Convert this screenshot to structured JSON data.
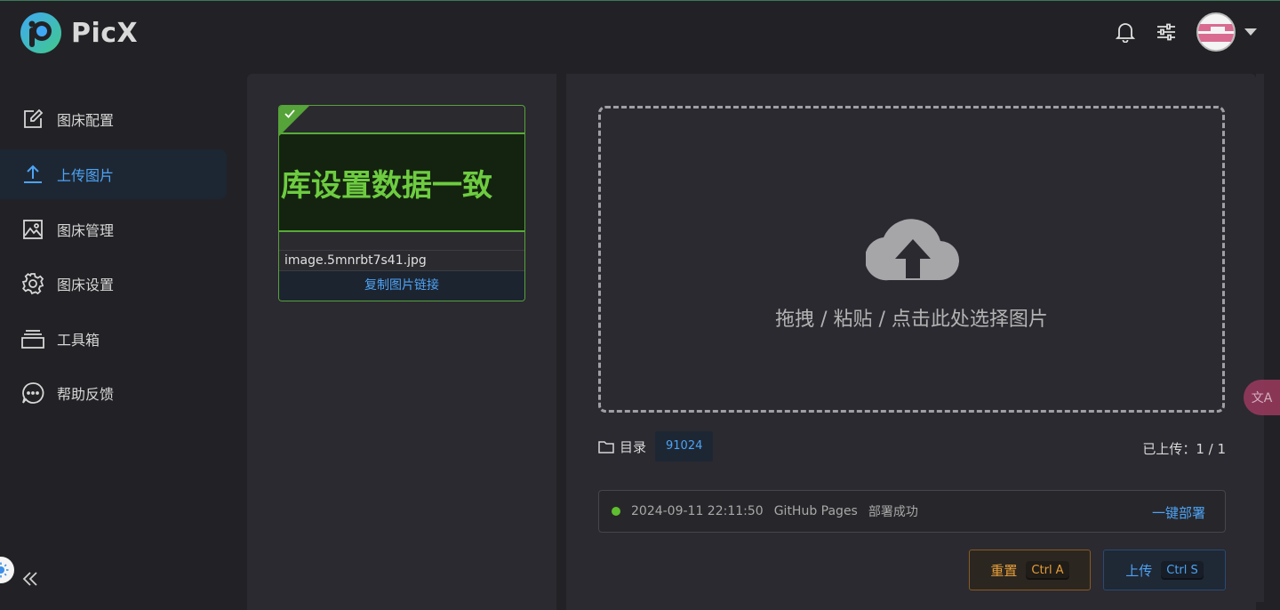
{
  "app": {
    "name": "PicX"
  },
  "sidebar": {
    "items": [
      {
        "label": "图床配置",
        "icon": "edit-icon"
      },
      {
        "label": "上传图片",
        "icon": "upload-icon",
        "active": true
      },
      {
        "label": "图床管理",
        "icon": "image-icon"
      },
      {
        "label": "图床设置",
        "icon": "gear-icon"
      },
      {
        "label": "工具箱",
        "icon": "toolbox-icon"
      },
      {
        "label": "帮助反馈",
        "icon": "chat-icon"
      }
    ]
  },
  "uploaded_list": {
    "cards": [
      {
        "preview_text": "库设置数据一致",
        "filename": "image.5mnrbt7s41.jpg",
        "copy_label": "复制图片链接",
        "status": "uploaded"
      }
    ]
  },
  "upload": {
    "drop_text": "拖拽 / 粘贴 / 点击此处选择图片",
    "dir_label": "目录",
    "dir_value": "91024",
    "count_text": "已上传：1 / 1"
  },
  "deploy": {
    "timestamp": "2024-09-11 22:11:50",
    "target": "GitHub Pages",
    "status": "部署成功",
    "action_label": "一键部署",
    "status_color": "#5fbf2e"
  },
  "actions": {
    "reset_label": "重置",
    "reset_shortcut": "Ctrl A",
    "upload_label": "上传",
    "upload_shortcut": "Ctrl S"
  },
  "translate_float": {
    "label": "文A"
  },
  "colors": {
    "accent": "#4ea3f5",
    "success": "#55a339",
    "warning": "#e69e3a"
  }
}
